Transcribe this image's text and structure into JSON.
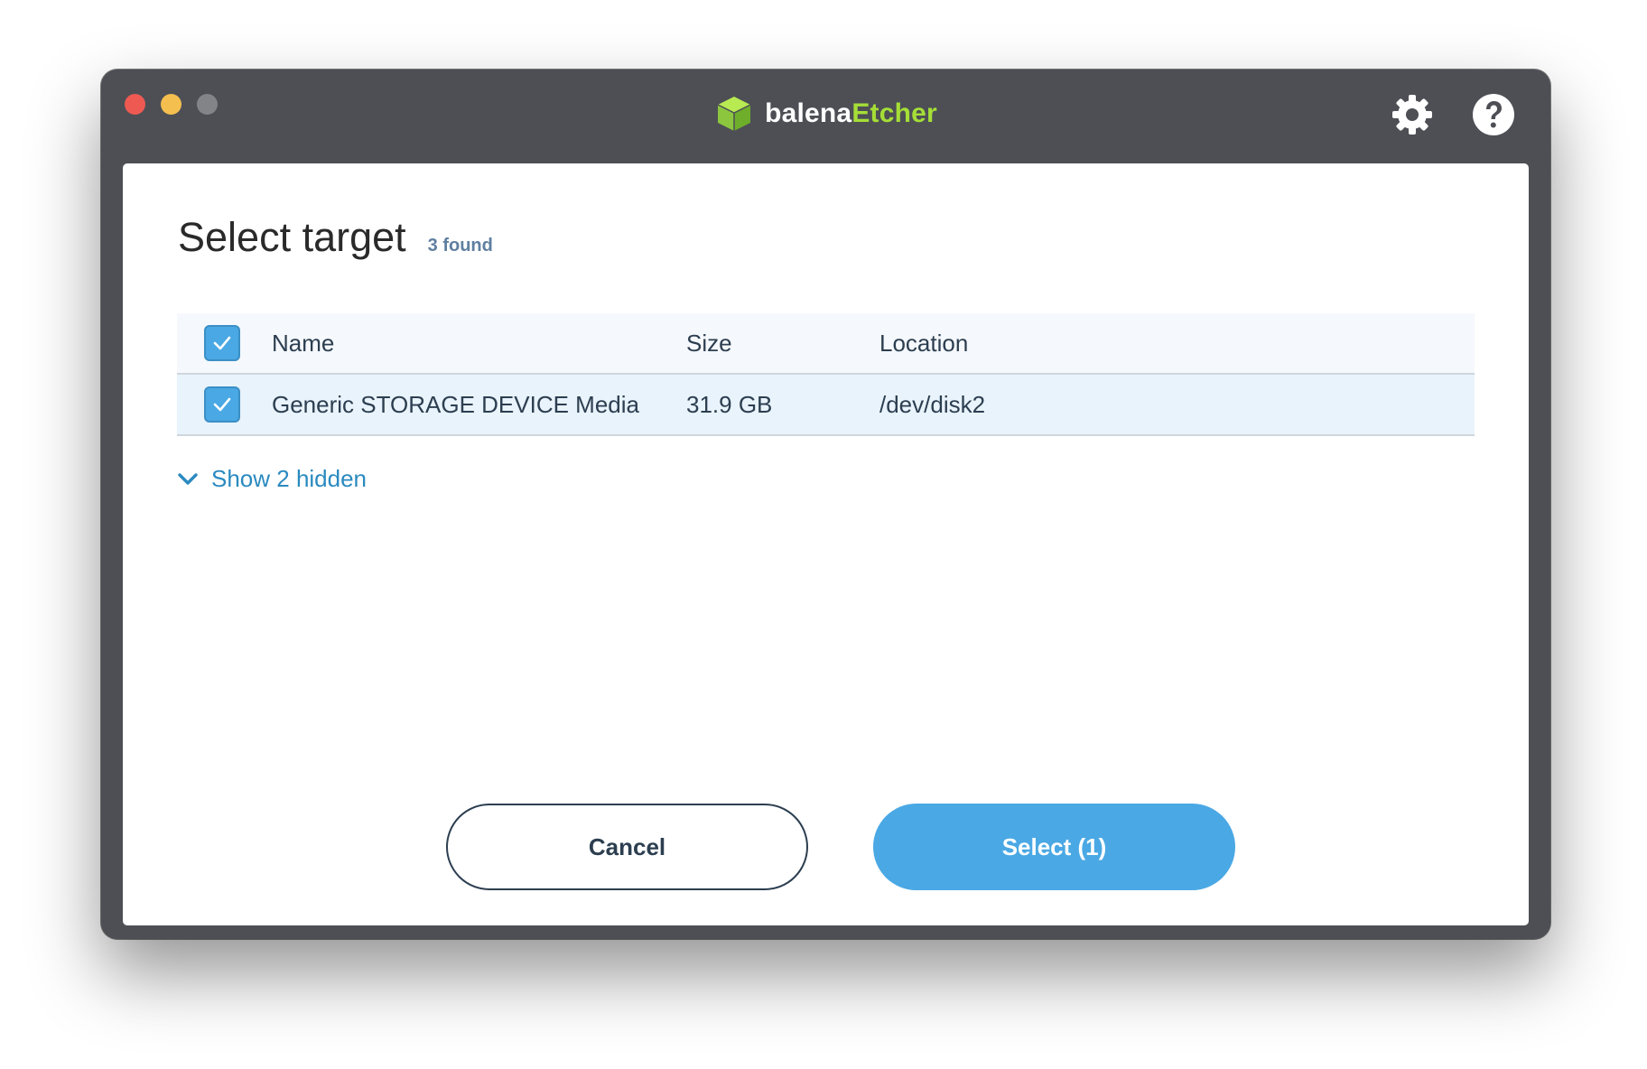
{
  "app": {
    "brand_part1": "balena",
    "brand_part2": "Etcher",
    "brand_colors": {
      "primary": "#ffffff",
      "accent": "#a5de37"
    },
    "header_icons": [
      "gear-icon",
      "help-icon"
    ]
  },
  "dialog": {
    "title": "Select target",
    "found_count": "3 found",
    "columns": {
      "name": "Name",
      "size": "Size",
      "location": "Location"
    },
    "header_checkbox_checked": true,
    "rows": [
      {
        "name": "Generic STORAGE DEVICE Media",
        "size": "31.9 GB",
        "location": "/dev/disk2",
        "checked": true
      }
    ],
    "show_hidden_label": "Show 2 hidden",
    "cancel_label": "Cancel",
    "select_label": "Select (1)",
    "accent_color": "#4aa8e4"
  }
}
